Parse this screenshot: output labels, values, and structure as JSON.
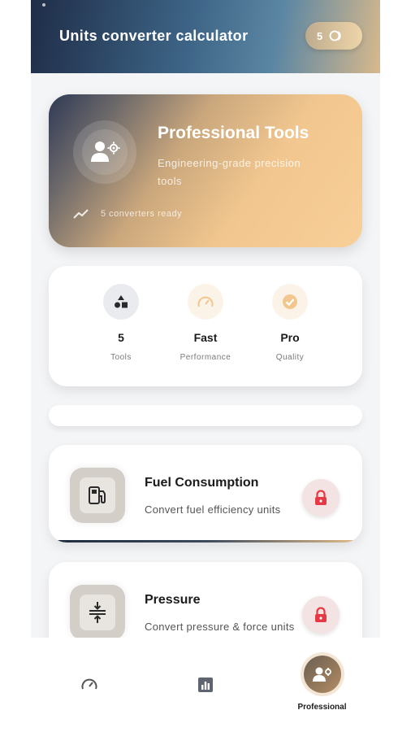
{
  "header": {
    "title": "Units converter calculator",
    "badge_count": "5",
    "badge_icon": "coin-stack-icon"
  },
  "hero": {
    "title": "Professional Tools",
    "subtitle": "Engineering-grade precision tools",
    "status": "5 converters ready",
    "icon": "engineer-gear-icon",
    "status_icon": "trend-line-icon"
  },
  "stats": [
    {
      "value": "5",
      "label": "Tools",
      "icon": "shapes-icon"
    },
    {
      "value": "Fast",
      "label": "Performance",
      "icon": "speedometer-icon"
    },
    {
      "value": "Pro",
      "label": "Quality",
      "icon": "verified-check-icon"
    }
  ],
  "tools": [
    {
      "title": "Fuel Consumption",
      "description": "Convert fuel efficiency units",
      "icon": "fuel-pump-icon",
      "locked": true
    },
    {
      "title": "Pressure",
      "description": "Convert pressure & force units",
      "icon": "pressure-compress-icon",
      "locked": true
    }
  ],
  "nav": [
    {
      "label": "",
      "icon": "speedometer-icon",
      "active": false
    },
    {
      "label": "",
      "icon": "bar-chart-icon",
      "active": false
    },
    {
      "label": "Professional",
      "icon": "professional-user-icon",
      "active": true
    }
  ],
  "colors": {
    "header_start": "#1f2d48",
    "header_end": "#d8b98c",
    "accent_gold": "#f2c78f",
    "lock_red": "#e53945"
  }
}
